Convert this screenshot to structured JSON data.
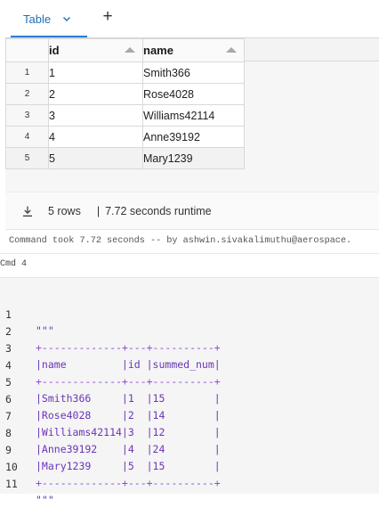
{
  "tabs": {
    "active_label": "Table",
    "add_label": "+"
  },
  "table": {
    "columns": [
      "id",
      "name"
    ],
    "rows": [
      {
        "rownum": "1",
        "id": "1",
        "name": "Smith366"
      },
      {
        "rownum": "2",
        "id": "2",
        "name": "Rose4028"
      },
      {
        "rownum": "3",
        "id": "3",
        "name": "Williams42114"
      },
      {
        "rownum": "4",
        "id": "4",
        "name": "Anne39192"
      },
      {
        "rownum": "5",
        "id": "5",
        "name": "Mary1239"
      }
    ]
  },
  "status": {
    "rows_text": "5 rows",
    "separator": "|",
    "runtime_text": "7.72 seconds runtime"
  },
  "command": {
    "took_text": "Command took 7.72 seconds -- by ashwin.sivakalimuthu@aerospace.",
    "cmd_label": "Cmd 4"
  },
  "code_cell": {
    "lines": [
      {
        "n": "1",
        "text": "\"\"\""
      },
      {
        "n": "2",
        "text": "+-------------+---+----------+"
      },
      {
        "n": "3",
        "text": "|name         |id |summed_num|"
      },
      {
        "n": "4",
        "text": "+-------------+---+----------+"
      },
      {
        "n": "5",
        "text": "|Smith366     |1  |15        |"
      },
      {
        "n": "6",
        "text": "|Rose4028     |2  |14        |"
      },
      {
        "n": "7",
        "text": "|Williams42114|3  |12        |"
      },
      {
        "n": "8",
        "text": "|Anne39192    |4  |24        |"
      },
      {
        "n": "9",
        "text": "|Mary1239     |5  |15        |"
      },
      {
        "n": "10",
        "text": "+-------------+---+----------+"
      },
      {
        "n": "11",
        "text": "\"\"\""
      }
    ]
  },
  "icons": {
    "chevron": "chevron-down-icon",
    "download": "download-icon",
    "sort": "sort-arrow-icon"
  },
  "colors": {
    "tab_active": "#1f6fb2",
    "code_text": "#6a34b8"
  }
}
